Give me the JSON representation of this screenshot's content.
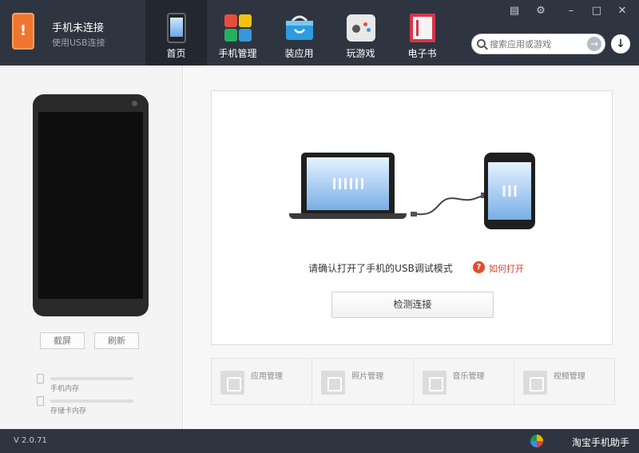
{
  "status": {
    "title": "手机未连接",
    "subtitle": "使用USB连接",
    "icon": "phone-warning-icon"
  },
  "nav": {
    "tabs": [
      {
        "label": "首页",
        "icon": "phone-home-icon",
        "active": true
      },
      {
        "label": "手机管理",
        "icon": "manage-grid-icon",
        "active": false
      },
      {
        "label": "装应用",
        "icon": "app-store-icon",
        "active": false
      },
      {
        "label": "玩游戏",
        "icon": "gamepad-icon",
        "active": false
      },
      {
        "label": "电子书",
        "icon": "book-icon",
        "active": false
      }
    ]
  },
  "window_controls": [
    "chat-icon",
    "gear-icon",
    "minimize-icon",
    "maximize-icon",
    "close-icon"
  ],
  "search": {
    "placeholder": "搜索应用或游戏"
  },
  "left_panel": {
    "screenshot_label": "截屏",
    "refresh_label": "刷新",
    "storage": [
      {
        "label": "手机内存",
        "icon": "phone-storage-icon",
        "used": 0
      },
      {
        "label": "存储卡内存",
        "icon": "sd-card-icon",
        "used": 0
      }
    ]
  },
  "main": {
    "instruction": "请确认打开了手机的USB调试模式",
    "help_link": "如何打开",
    "detect_button": "检测连接",
    "quick_actions": [
      {
        "label": "应用管理",
        "icon": "apps-manage-icon"
      },
      {
        "label": "照片管理",
        "icon": "photo-icon"
      },
      {
        "label": "音乐管理",
        "icon": "music-icon"
      },
      {
        "label": "视频管理",
        "icon": "video-icon"
      }
    ]
  },
  "footer": {
    "version": "V 2.0.71",
    "brand": "淘宝手机助手"
  },
  "colors": {
    "header_bg": "#2f3540",
    "active_tab_bg": "#232830",
    "accent_orange": "#f0762f",
    "help_red": "#e44b2f"
  }
}
